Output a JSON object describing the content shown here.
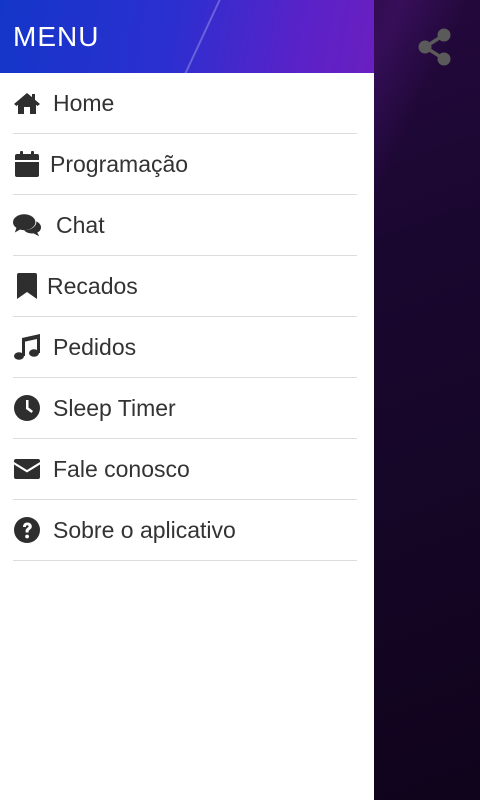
{
  "drawer": {
    "title": "MENU",
    "items": [
      {
        "label": "Home",
        "icon": "home-icon"
      },
      {
        "label": "Programação",
        "icon": "calendar-icon"
      },
      {
        "label": "Chat",
        "icon": "chat-icon"
      },
      {
        "label": "Recados",
        "icon": "bookmark-icon"
      },
      {
        "label": "Pedidos",
        "icon": "music-note-icon"
      },
      {
        "label": "Sleep Timer",
        "icon": "clock-icon"
      },
      {
        "label": "Fale conosco",
        "icon": "envelope-icon"
      },
      {
        "label": "Sobre o aplicativo",
        "icon": "question-circle-icon"
      }
    ]
  },
  "toolbar": {
    "share_icon": "share-icon"
  },
  "colors": {
    "header_start": "#1436c8",
    "header_end": "#6a1fc0",
    "icon": "#2e2e2e",
    "text": "#333333"
  }
}
